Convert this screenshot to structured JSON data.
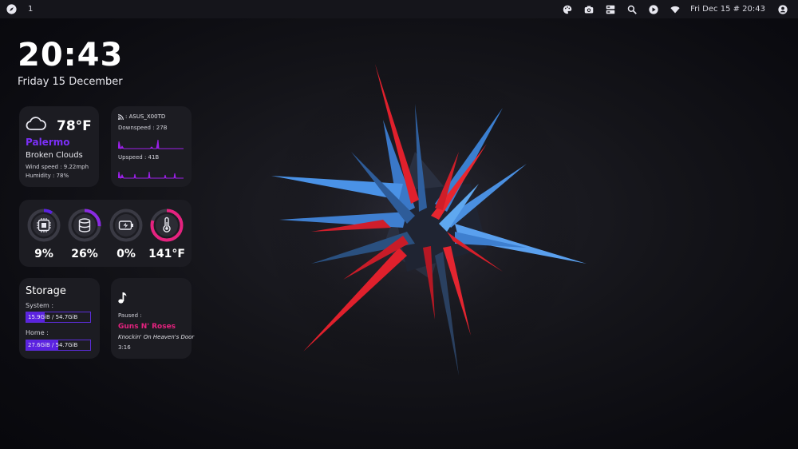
{
  "topbar": {
    "workspace": "1",
    "datetime": "Fri Dec 15 # 20:43",
    "icons": [
      "compass-icon",
      "palette-icon",
      "camera-icon",
      "dashboard-icon",
      "search-icon",
      "play-icon",
      "wifi-icon",
      "user-icon"
    ]
  },
  "clock": {
    "time": "20:43",
    "date": "Friday 15 December"
  },
  "weather": {
    "temperature": "78°F",
    "city": "Palermo",
    "condition": "Broken Clouds",
    "wind": "Wind speed : 9.22mph",
    "humidity": "Humidity : 78%",
    "icon": "cloud-icon"
  },
  "network": {
    "ssid": ": ASUS_X00TD",
    "downspeed": "Downspeed : 27B",
    "upspeed": "Upspeed : 41B",
    "graph_color": "#9b1fe8"
  },
  "system": {
    "cpu": {
      "value": "9%",
      "fraction": 0.09
    },
    "disk": {
      "value": "26%",
      "fraction": 0.26
    },
    "battery": {
      "value": "0%",
      "fraction": 0.0
    },
    "temp": {
      "value": "141°F",
      "fraction": 0.8
    }
  },
  "storage": {
    "title": "Storage",
    "system_label": "System :",
    "system_value": "15.9GiB / 54.7GiB",
    "system_fraction": 0.29,
    "home_label": "Home :",
    "home_value": "27.6GiB / 54.7GiB",
    "home_fraction": 0.5
  },
  "music": {
    "state": "Paused :",
    "artist": "Guns N' Roses",
    "song": "Knockin' On Heaven's Door",
    "time": "3:16"
  },
  "colors": {
    "accent_purple": "#7b2ff7",
    "accent_pink": "#e5227f",
    "card_bg": "#1c1c22"
  }
}
